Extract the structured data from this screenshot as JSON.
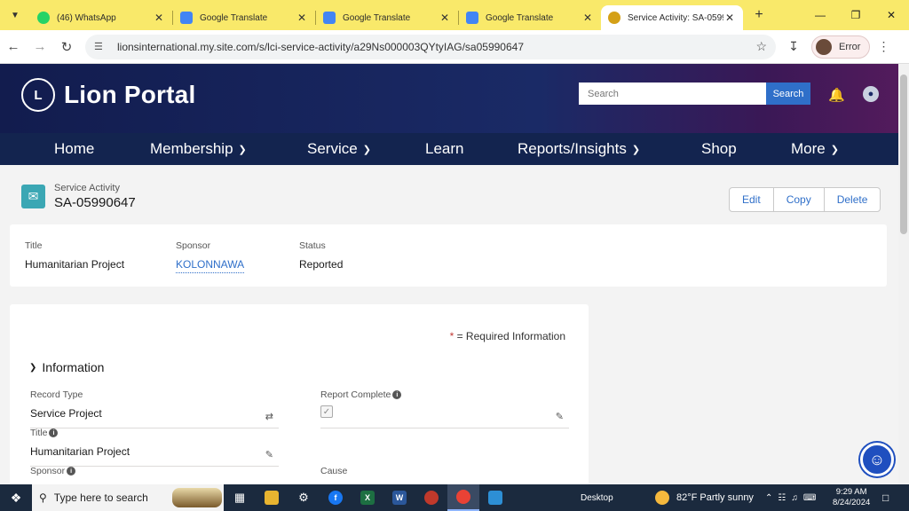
{
  "browser": {
    "tabs": [
      {
        "title": "(46) WhatsApp",
        "favicon_color": "#25d366",
        "active": false
      },
      {
        "title": "Google Translate",
        "favicon_color": "#4285f4",
        "active": false
      },
      {
        "title": "Google Translate",
        "favicon_color": "#4285f4",
        "active": false
      },
      {
        "title": "Google Translate",
        "favicon_color": "#4285f4",
        "active": false
      },
      {
        "title": "Service Activity: SA-0599",
        "favicon_color": "#d4a017",
        "active": true
      }
    ],
    "url": "lionsinternational.my.site.com/s/lci-service-activity/a29Ns000003QYtyIAG/sa05990647",
    "profile_label": "Error"
  },
  "portal": {
    "brand": "Lion Portal",
    "search_placeholder": "Search",
    "search_button": "Search",
    "nav": [
      {
        "label": "Home",
        "has_menu": false
      },
      {
        "label": "Membership",
        "has_menu": true
      },
      {
        "label": "Service",
        "has_menu": true
      },
      {
        "label": "Learn",
        "has_menu": false
      },
      {
        "label": "Reports/Insights",
        "has_menu": true
      },
      {
        "label": "Shop",
        "has_menu": false
      },
      {
        "label": "More",
        "has_menu": true
      }
    ]
  },
  "record": {
    "object_label": "Service Activity",
    "name": "SA-05990647",
    "actions": [
      "Edit",
      "Copy",
      "Delete"
    ],
    "highlights": [
      {
        "label": "Title",
        "value": "Humanitarian Project",
        "is_link": false
      },
      {
        "label": "Sponsor",
        "value": "KOLONNAWA",
        "is_link": true
      },
      {
        "label": "Status",
        "value": "Reported",
        "is_link": false
      }
    ]
  },
  "detail": {
    "required_note": "= Required Information",
    "section_title": "Information",
    "fields": {
      "record_type": {
        "label": "Record Type",
        "value": "Service Project"
      },
      "report_complete": {
        "label": "Report Complete",
        "checked": true
      },
      "title": {
        "label": "Title",
        "value": "Humanitarian Project"
      },
      "sponsor": {
        "label": "Sponsor"
      },
      "cause": {
        "label": "Cause"
      }
    }
  },
  "taskbar": {
    "search_placeholder": "Type here to search",
    "desktop_label": "Desktop",
    "weather": "82°F  Partly sunny",
    "time": "9:29 AM",
    "date": "8/24/2024"
  }
}
